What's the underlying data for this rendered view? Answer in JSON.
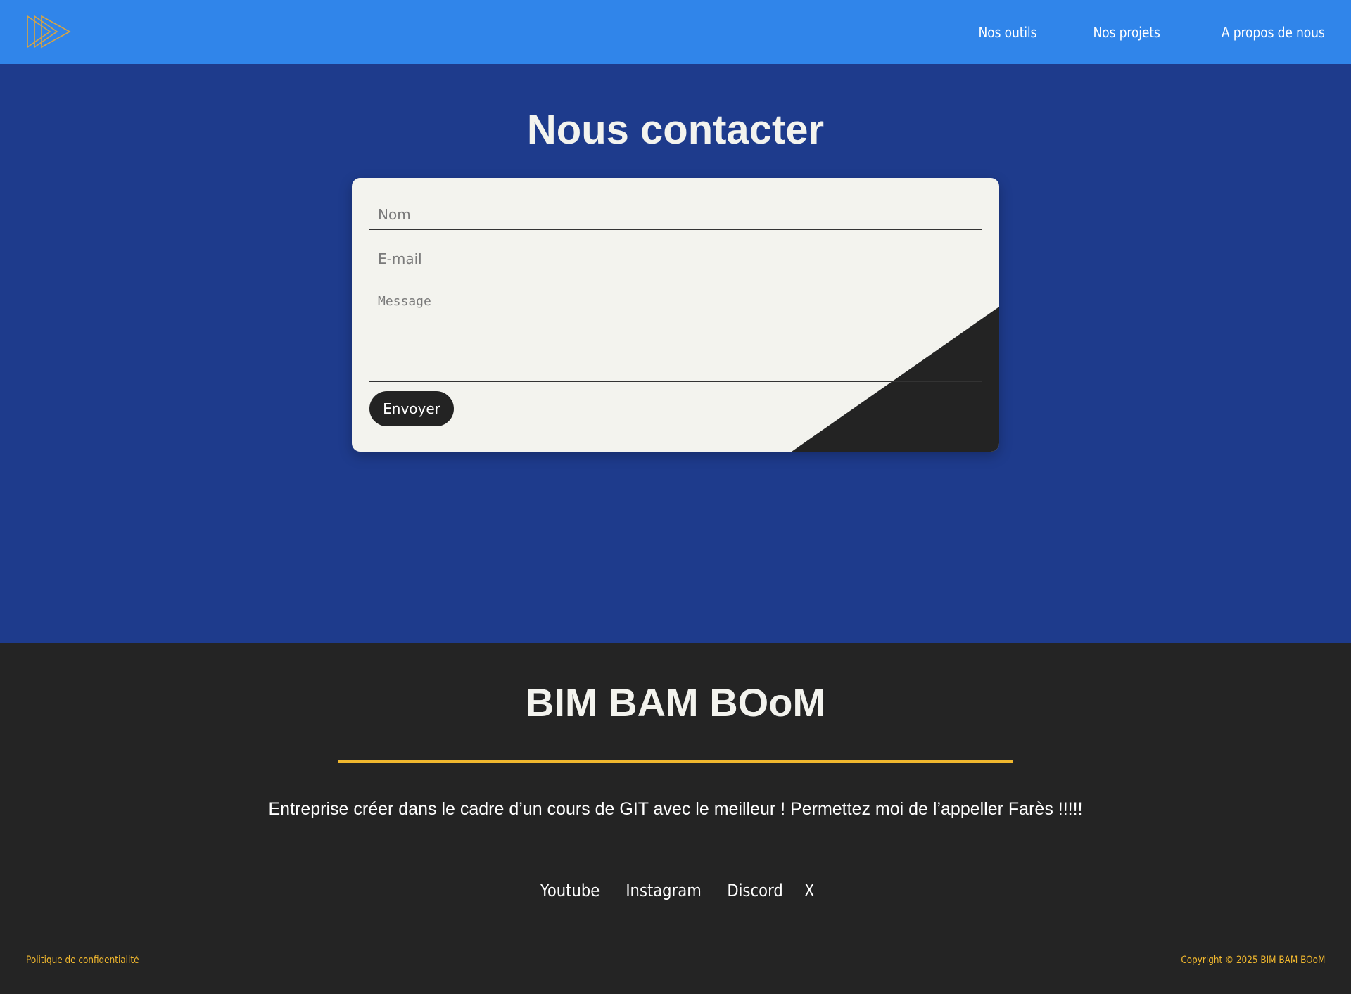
{
  "header": {
    "logo_icon": "triple-play-outline-icon",
    "nav": [
      {
        "label": "Nos outils"
      },
      {
        "label": "Nos projets"
      },
      {
        "label": "A propos de nous"
      }
    ]
  },
  "main": {
    "title": "Nous contacter",
    "form": {
      "name_placeholder": "Nom",
      "email_placeholder": "E-mail",
      "message_placeholder": "Message",
      "submit_label": "Envoyer"
    }
  },
  "footer": {
    "brand": "BIM BAM BOoM",
    "tagline": "Entreprise créer dans le cadre d’un cours de GIT avec le meilleur ! Permettez moi de l’appeller Farès !!!!!",
    "social": [
      "Youtube",
      "Instagram",
      "Discord",
      "X"
    ],
    "privacy_link": "Politique de confidentialité",
    "copyright": "Copyright © 2025 BIM BAM BOoM"
  },
  "colors": {
    "header_bg": "#3085ea",
    "main_bg": "#1e3b8c",
    "card_bg": "#f3f3ee",
    "dark": "#232323",
    "accent": "#f0b72e"
  }
}
